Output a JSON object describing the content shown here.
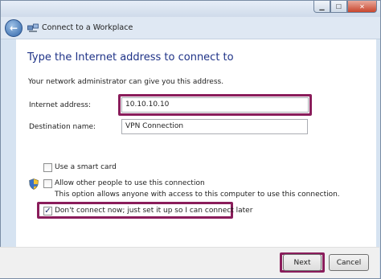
{
  "window": {
    "title": "Connect to a Workplace",
    "caption_buttons": {
      "minimize": "▁",
      "maximize": "☐",
      "close": "✕"
    }
  },
  "page": {
    "heading": "Type the Internet address to connect to",
    "description": "Your network administrator can give you this address."
  },
  "form": {
    "internet_address_label": "Internet address:",
    "internet_address_value": "10.10.10.10",
    "destination_name_label": "Destination name:",
    "destination_name_value": "VPN Connection"
  },
  "options": {
    "smart_card": {
      "label": "Use a smart card",
      "checked": false
    },
    "allow_others": {
      "label": "Allow other people to use this connection",
      "note": "This option allows anyone with access to this computer to use this connection.",
      "checked": false
    },
    "dont_connect": {
      "label": "Don't connect now; just set it up so I can connect later",
      "checked": true,
      "check_mark": "✓"
    }
  },
  "buttons": {
    "next": "Next",
    "cancel": "Cancel"
  },
  "icons": {
    "back": "back-arrow-icon",
    "vpn": "vpn-network-icon",
    "shield": "uac-shield-icon"
  },
  "colors": {
    "highlight": "#8a1d5b",
    "heading": "#1e3287"
  }
}
